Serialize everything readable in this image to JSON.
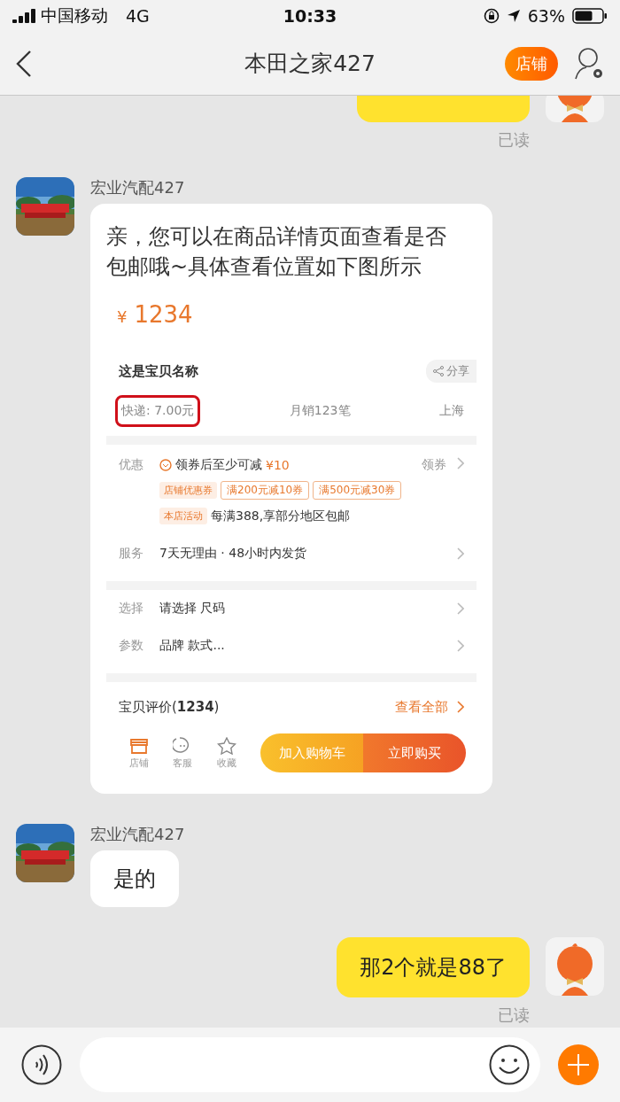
{
  "status_bar": {
    "carrier": "中国移动",
    "network": "4G",
    "time": "10:33",
    "battery": "63%"
  },
  "header": {
    "title": "本田之家427",
    "shop_button": "店铺"
  },
  "messages": [
    {
      "kind": "outgoing-cut",
      "receipt": "已读"
    },
    {
      "kind": "product-card",
      "sender": "宏业汽配427",
      "text": "亲，您可以在商品详情页面查看是否包邮哦~具体查看位置如下图所示",
      "screenshot": {
        "currency": "¥",
        "price": "1234",
        "product_name": "这是宝贝名称",
        "share": "分享",
        "shipping": "快递: 7.00元",
        "shipping_highlighted": true,
        "monthly_sales": "月销123笔",
        "location": "上海",
        "promo": {
          "label": "优惠",
          "headline": "领券后至少可减",
          "amount": "¥10",
          "action": "领券",
          "coupon_tag": "店铺优惠券",
          "coupons": [
            "满200元减10券",
            "满500元减30券"
          ],
          "activity_tag": "本店活动",
          "activity": "每满388,享部分地区包邮"
        },
        "sections": [
          [
            {
              "label": "服务",
              "value": "7天无理由 · 48小时内发货"
            }
          ],
          [
            {
              "label": "选择",
              "value": "请选择 尺码"
            },
            {
              "label": "参数",
              "value": "品牌 款式..."
            }
          ]
        ],
        "reviews": "宝贝评价(**1234**)",
        "reviews_link": "查看全部",
        "actions": [
          {
            "kind": "store",
            "label": "店铺"
          },
          {
            "kind": "service",
            "label": "客服"
          },
          {
            "kind": "favorite",
            "label": "收藏"
          }
        ],
        "cart_button": "加入购物车",
        "buy_button": "立即购买"
      }
    },
    {
      "kind": "incoming",
      "sender": "宏业汽配427",
      "text": "是的"
    },
    {
      "kind": "outgoing",
      "text": "那2个就是88了",
      "receipt": "已读"
    }
  ]
}
